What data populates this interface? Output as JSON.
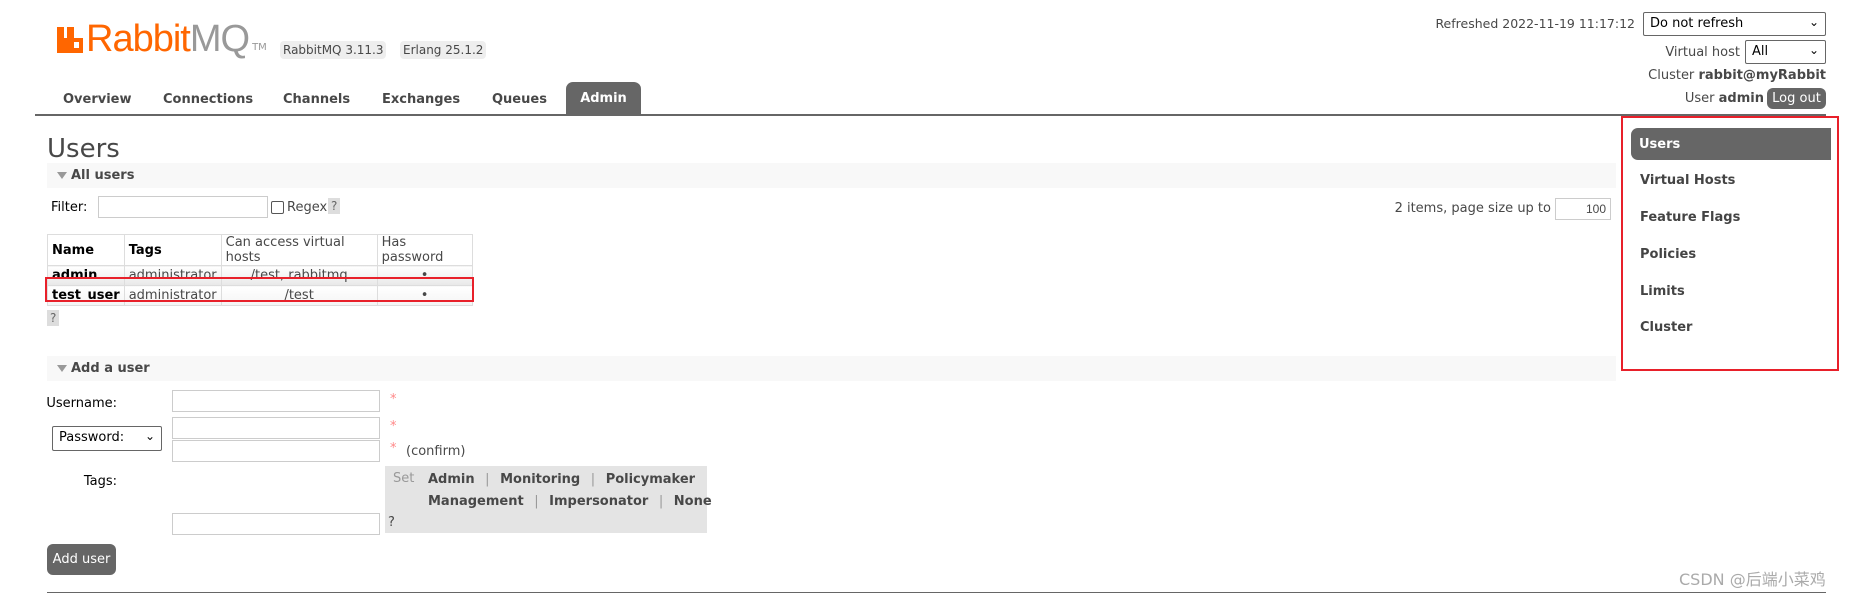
{
  "header": {
    "logo_text": "RabbitMQ",
    "logo_tm": "TM",
    "version_badge": "RabbitMQ 3.11.3",
    "erlang_badge": "Erlang 25.1.2",
    "refreshed": "Refreshed 2022-11-19 11:17:12",
    "refresh_select": "Do not refresh",
    "virtual_host_label": "Virtual host",
    "virtual_host_select": "All",
    "cluster_label": "Cluster",
    "cluster_name": "rabbit@myRabbit",
    "user_label": "User",
    "user_name": "admin",
    "logout": "Log out"
  },
  "tabs": [
    {
      "label": "Overview"
    },
    {
      "label": "Connections"
    },
    {
      "label": "Channels"
    },
    {
      "label": "Exchanges"
    },
    {
      "label": "Queues"
    },
    {
      "label": "Admin",
      "active": true
    }
  ],
  "page_title": "Users",
  "all_users": {
    "section_label": "All users",
    "filter_label": "Filter:",
    "filter_value": "",
    "regex_label": "Regex",
    "help": "?",
    "items_text": "2 items, page size up to",
    "page_size": "100",
    "columns": [
      "Name",
      "Tags",
      "Can access virtual hosts",
      "Has password"
    ],
    "rows": [
      {
        "name": "admin",
        "tags": "administrator",
        "vhosts": "/test, rabbitmq",
        "has_password": "•"
      },
      {
        "name": "test_user",
        "tags": "administrator",
        "vhosts": "/test",
        "has_password": "•"
      }
    ]
  },
  "add_user": {
    "section_label": "Add a user",
    "username_label": "Username:",
    "password_select": "Password:",
    "required": "*",
    "confirm": "(confirm)",
    "tags_label": "Tags:",
    "set_label": "Set",
    "tag_options_row1": [
      "Admin",
      "Monitoring",
      "Policymaker"
    ],
    "tag_options_row2": [
      "Management",
      "Impersonator",
      "None"
    ],
    "separator": "|",
    "help": "?",
    "submit": "Add user"
  },
  "admin_nav": [
    {
      "label": "Users",
      "active": true
    },
    {
      "label": "Virtual Hosts"
    },
    {
      "label": "Feature Flags"
    },
    {
      "label": "Policies"
    },
    {
      "label": "Limits"
    },
    {
      "label": "Cluster"
    }
  ],
  "watermark": "CSDN @后端小菜鸡",
  "colors": {
    "brand": "#ff6600",
    "highlight_box": "#e8202a",
    "active_tab": "#666666"
  }
}
